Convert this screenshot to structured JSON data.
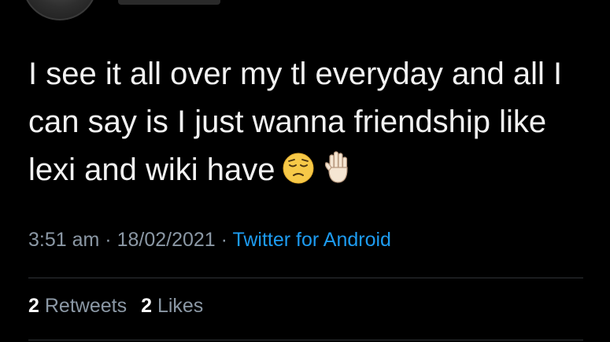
{
  "tweet": {
    "lines": [
      "I see it all over my tl everyday and all I",
      "can say is I just wanna friendship like",
      "lexi and wiki have"
    ],
    "emojis": [
      "pensive-face-icon",
      "raised-hand-icon"
    ]
  },
  "meta": {
    "time": "3:51 am",
    "separator": "·",
    "date": "18/02/2021",
    "source": "Twitter for Android"
  },
  "stats": {
    "retweets_count": "2",
    "retweets_label": "Retweets",
    "likes_count": "2",
    "likes_label": "Likes"
  },
  "colors": {
    "background": "#000000",
    "text": "#f2f2f2",
    "muted": "#8b98a5",
    "link": "#1d9bf0",
    "divider": "#2f3336"
  }
}
